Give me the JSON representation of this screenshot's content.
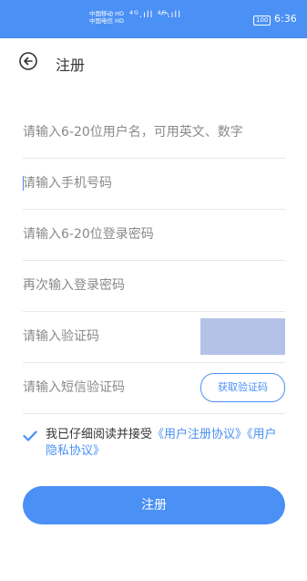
{
  "status_bar": {
    "carrier_1": "中国移动 HD",
    "carrier_2": "中国电信 HD",
    "signal": "⁴ᴳ.ıll ⁴ᴳ.ıll",
    "wifi": "◠",
    "battery": "100",
    "time": "6:36"
  },
  "header": {
    "title": "注册"
  },
  "form": {
    "username_placeholder": "请输入6-20位用户名，可用英文、数字",
    "phone_placeholder": "请输入手机号码",
    "password_placeholder": "请输入6-20位登录密码",
    "password_confirm_placeholder": "再次输入登录密码",
    "captcha_placeholder": "请输入验证码",
    "sms_code_placeholder": "请输入短信验证码",
    "sms_button_label": "获取验证码"
  },
  "agreement": {
    "prefix": "我已仔细阅读并接受",
    "user_agreement": "《用户注册协议》",
    "privacy_policy": "《用户隐私协议》",
    "checked": true
  },
  "submit_label": "注册",
  "colors": {
    "accent": "#4a90f5",
    "captcha_bg": "#b4c2e8"
  }
}
